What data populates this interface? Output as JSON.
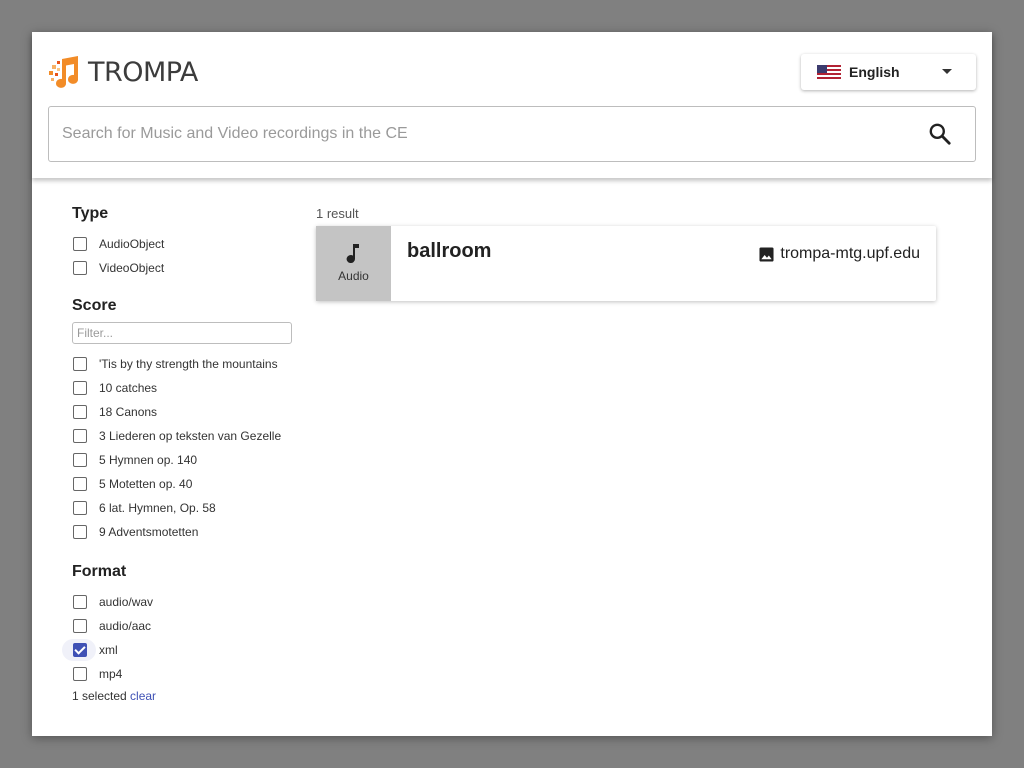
{
  "header": {
    "logo_text": "TROMPA",
    "language": {
      "label": "English",
      "flag": "us-flag-icon"
    },
    "search": {
      "placeholder": "Search for Music and Video recordings in the CE",
      "value": "",
      "icon": "search-icon"
    }
  },
  "sidebar": {
    "type": {
      "title": "Type",
      "items": [
        {
          "label": "AudioObject",
          "checked": false
        },
        {
          "label": "VideoObject",
          "checked": false
        }
      ]
    },
    "score": {
      "title": "Score",
      "filter_placeholder": "Filter...",
      "items": [
        {
          "label": "'Tis by thy strength the mountains",
          "checked": false
        },
        {
          "label": "10 catches",
          "checked": false
        },
        {
          "label": "18 Canons",
          "checked": false
        },
        {
          "label": "3 Liederen op teksten van Gezelle",
          "checked": false
        },
        {
          "label": "5 Hymnen op. 140",
          "checked": false
        },
        {
          "label": "5 Motetten op. 40",
          "checked": false
        },
        {
          "label": "6 lat. Hymnen, Op. 58",
          "checked": false
        },
        {
          "label": "9 Adventsmotetten",
          "checked": false
        }
      ]
    },
    "format": {
      "title": "Format",
      "items": [
        {
          "label": "audio/wav",
          "checked": false
        },
        {
          "label": "audio/aac",
          "checked": false
        },
        {
          "label": "xml",
          "checked": true
        },
        {
          "label": "mp4",
          "checked": false
        }
      ],
      "selected_text": "1 selected",
      "clear_label": "clear"
    }
  },
  "results": {
    "count_text": "1 result",
    "items": [
      {
        "type_label": "Audio",
        "title": "ballroom",
        "source": "trompa-mtg.upf.edu"
      }
    ]
  },
  "colors": {
    "accent": "#3f51b5",
    "logo_orange": "#f28c28",
    "thumb_bg": "#c4c4c4"
  }
}
